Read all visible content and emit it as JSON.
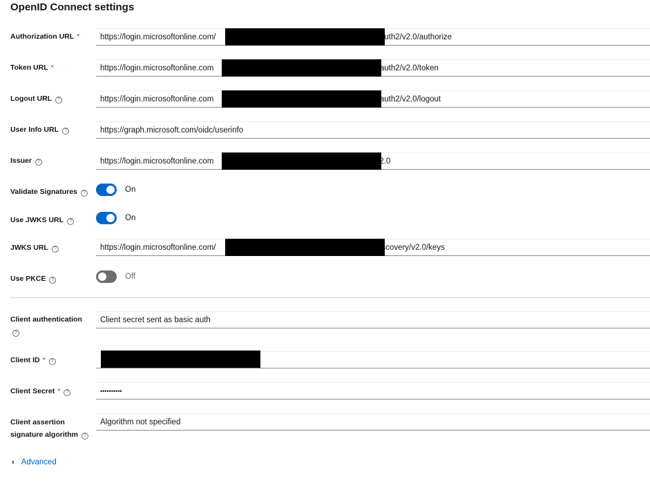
{
  "title": "OpenID Connect settings",
  "fields": {
    "authorization_url": {
      "label": "Authorization URL",
      "value_prefix": "https://login.microsoftonline.com/",
      "value_suffix": "oauth2/v2.0/authorize"
    },
    "token_url": {
      "label": "Token URL",
      "value_prefix": "https://login.microsoftonline.com",
      "value_suffix": "/oauth2/v2.0/token"
    },
    "logout_url": {
      "label": "Logout URL",
      "value_prefix": "https://login.microsoftonline.com",
      "value_suffix": "/oauth2/v2.0/logout"
    },
    "user_info_url": {
      "label": "User Info URL",
      "value": "https://graph.microsoft.com/oidc/userinfo"
    },
    "issuer": {
      "label": "Issuer",
      "value_prefix": "https://login.microsoftonline.com",
      "value_suffix": "/v2.0"
    },
    "jwks_url": {
      "label": "JWKS URL",
      "value_prefix": "https://login.microsoftonline.com/",
      "value_suffix": "discovery/v2.0/keys"
    },
    "client_authentication": {
      "label": "Client authentication",
      "value": "Client secret sent as basic auth"
    },
    "client_id": {
      "label": "Client ID"
    },
    "client_secret": {
      "label": "Client Secret",
      "value": "••••••••••"
    },
    "client_assertion": {
      "label_line1": "Client assertion",
      "label_line2": "signature algorithm",
      "value": "Algorithm not specified"
    }
  },
  "toggles": {
    "validate_signatures": {
      "label": "Validate Signatures",
      "state": "On"
    },
    "use_jwks_url": {
      "label": "Use JWKS URL",
      "state": "On"
    },
    "use_pkce": {
      "label": "Use PKCE",
      "state": "Off"
    }
  },
  "required_marker": "*",
  "help_glyph": "?",
  "advanced": {
    "label": "Advanced",
    "chevron": "›"
  },
  "colors": {
    "accent": "#0066cc",
    "required": "#c9190b",
    "toggle_off": "#6a6e73",
    "redaction": "#000000"
  }
}
